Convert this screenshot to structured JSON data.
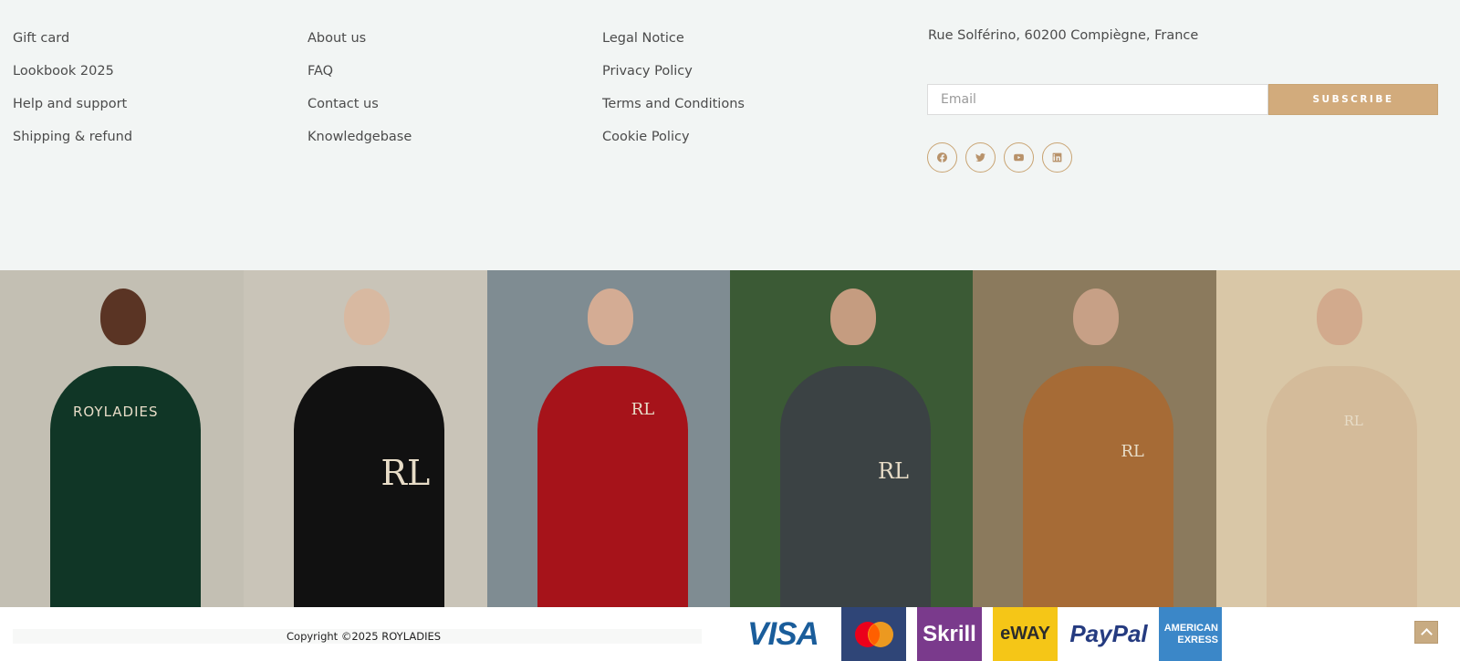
{
  "footer": {
    "column1": [
      "Gift card",
      "Lookbook 2025",
      "Help and support",
      "Shipping & refund"
    ],
    "column2": [
      "About us",
      "FAQ",
      "Contact us",
      "Knowledgebase"
    ],
    "column3": [
      "Legal Notice",
      "Privacy Policy",
      "Terms and Conditions",
      "Cookie Policy"
    ],
    "address": "Rue Solférino, 60200 Compiègne, France",
    "newsletter": {
      "placeholder": "Email",
      "button": "SUBSCRIBE"
    },
    "socials": [
      "facebook-icon",
      "twitter-icon",
      "youtube-icon",
      "linkedin-icon"
    ]
  },
  "gallery": {
    "images": [
      {
        "description": "model",
        "brand_text": "ROYLADIES",
        "colors": {
          "bg": "#c3bfb3",
          "outfit": "#103626",
          "skin": "#5a3424"
        }
      },
      {
        "description": "model",
        "brand_text": "RL",
        "colors": {
          "bg": "#c9c4b8",
          "outfit": "#111111",
          "skin": "#d8b9a1"
        }
      },
      {
        "description": "model",
        "brand_text": "RL",
        "colors": {
          "bg": "#7f8c92",
          "outfit": "#a6131a",
          "skin": "#d4ac94"
        }
      },
      {
        "description": "model",
        "brand_text": "RL",
        "colors": {
          "bg": "#3b5a35",
          "outfit": "#3b4244",
          "skin": "#c59c80"
        }
      },
      {
        "description": "model",
        "brand_text": "RL",
        "colors": {
          "bg": "#8b7a5d",
          "outfit": "#a66b36",
          "skin": "#c7a086"
        }
      },
      {
        "description": "model",
        "brand_text": "RL",
        "colors": {
          "bg": "#d9c7a7",
          "outfit": "#d4bb9a",
          "skin": "#d2aa8d"
        }
      }
    ]
  },
  "bottom": {
    "copyright": "Copyright ©2025 ROYLADIES",
    "payments": {
      "visa": "VISA",
      "skrill": "Skrill",
      "eway": "eWAY",
      "paypal": "PayPal",
      "amex_line1": "AMERICAN",
      "amex_line2": "EXRESS"
    }
  }
}
